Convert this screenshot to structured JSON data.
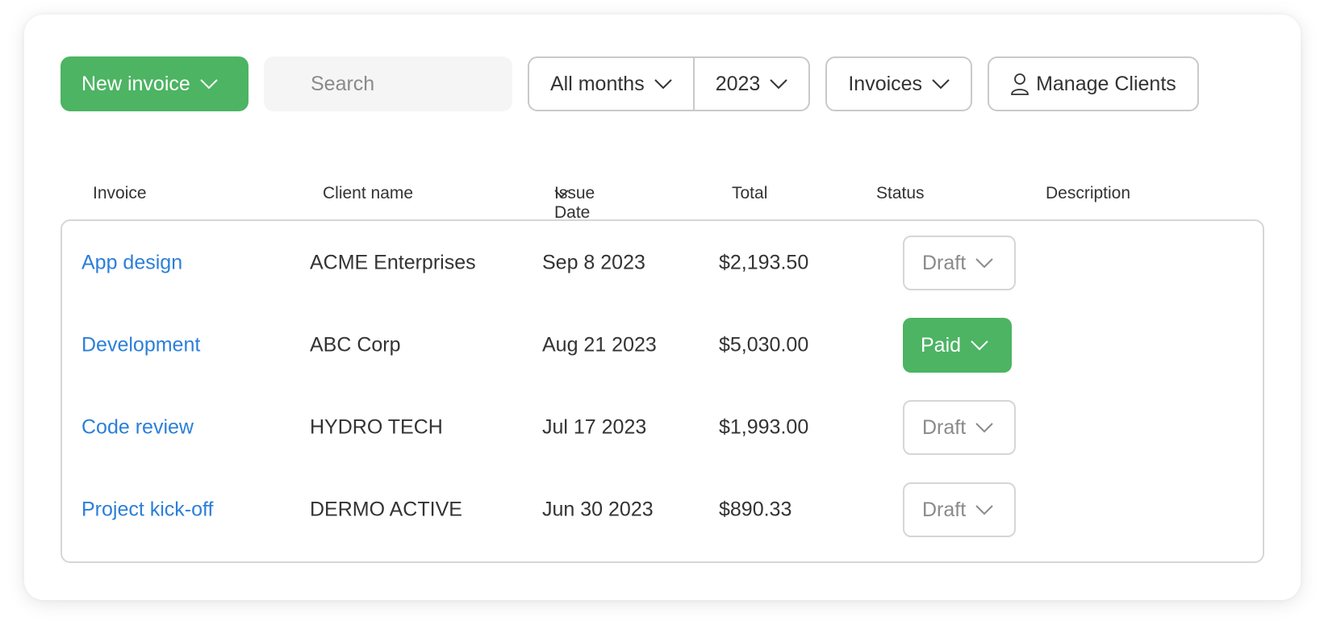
{
  "toolbar": {
    "new_invoice_label": "New invoice",
    "search_placeholder": "Search",
    "months_label": "All months",
    "year_label": "2023",
    "type_label": "Invoices",
    "manage_clients_label": "Manage Clients"
  },
  "table": {
    "headers": {
      "invoice": "Invoice",
      "client": "Client name",
      "issue_date": "Issue Date",
      "total": "Total",
      "status": "Status",
      "description": "Description"
    },
    "rows": [
      {
        "invoice": "App design",
        "client": "ACME Enterprises",
        "date": "Sep 8 2023",
        "total": "$2,193.50",
        "status": "Draft",
        "description": ""
      },
      {
        "invoice": "Development",
        "client": "ABC Corp",
        "date": "Aug 21 2023",
        "total": "$5,030.00",
        "status": "Paid",
        "description": ""
      },
      {
        "invoice": "Code review",
        "client": "HYDRO TECH",
        "date": "Jul 17 2023",
        "total": "$1,993.00",
        "status": "Draft",
        "description": ""
      },
      {
        "invoice": "Project kick-off",
        "client": "DERMO ACTIVE",
        "date": "Jun 30 2023",
        "total": "$890.33",
        "status": "Draft",
        "description": ""
      }
    ]
  },
  "colors": {
    "accent_green": "#4cb463",
    "link_blue": "#2b7fd9",
    "border_gray": "#c9c9c9"
  },
  "icons": {
    "dropdown": "chevron-down-icon",
    "clients": "user-icon",
    "sort": "chevron-down-icon"
  }
}
